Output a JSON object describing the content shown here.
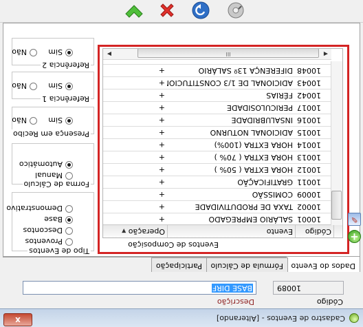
{
  "window": {
    "title": "Cadastro de Eventos - [Alterando]",
    "close_label": "x"
  },
  "fields": {
    "codigo_label": "Código",
    "codigo_value": "10089",
    "descricao_label": "Descrição",
    "descricao_value": "BASE DIRF"
  },
  "tabs": [
    {
      "label": "Dados do Evento",
      "active": true
    },
    {
      "label": "Fórmula de Cálculo",
      "active": false
    },
    {
      "label": "Participação",
      "active": false
    }
  ],
  "groups": {
    "tipo_eventos": {
      "title": "Tipo de Eventos",
      "options": [
        "Proventos",
        "Descontos",
        "Base",
        "Demonstrativo"
      ],
      "selected": "Base"
    },
    "forma_calculo": {
      "title": "Forma de Cálculo",
      "options": [
        "Manual",
        "Automático"
      ],
      "selected": "Automático"
    },
    "presenca_recibo": {
      "title": "Presença em Recibo",
      "options": [
        "Sim",
        "Não"
      ],
      "selected": "Sim"
    },
    "referencia_1": {
      "title": "Referência 1",
      "options": [
        "Sim",
        "Não"
      ],
      "selected": "Sim"
    },
    "referencia_2": {
      "title": "Referência 2",
      "options": [
        "Sim",
        "Não"
      ],
      "selected": "Sim"
    }
  },
  "composicao": {
    "title": "Eventos de Composição",
    "columns": [
      "Código",
      "Evento",
      "Operação"
    ],
    "rows": [
      {
        "code": "10001",
        "event": "SALÁRIO EMPREGADO",
        "op": "+",
        "current": true
      },
      {
        "code": "10002",
        "event": "TAXA DE PRODUTIVIDADE",
        "op": "+",
        "current": false
      },
      {
        "code": "10009",
        "event": "COMISSÃO",
        "op": "+",
        "current": false
      },
      {
        "code": "10011",
        "event": "GRATIFICAÇÃO",
        "op": "+",
        "current": false
      },
      {
        "code": "10012",
        "event": "HORA EXTRA ( 50% )",
        "op": "+",
        "current": false
      },
      {
        "code": "10013",
        "event": "HORA EXTRA ( 70% )",
        "op": "+",
        "current": false
      },
      {
        "code": "10014",
        "event": "HORA EXTRA (100%)",
        "op": "+",
        "current": false
      },
      {
        "code": "10015",
        "event": "ADICIONAL NOTURNO",
        "op": "+",
        "current": false
      },
      {
        "code": "10016",
        "event": "INSALUBRIDADE",
        "op": "+",
        "current": false
      },
      {
        "code": "10017",
        "event": "PERICULOSIDADE",
        "op": "+",
        "current": false
      },
      {
        "code": "10042",
        "event": "FÉRIAS",
        "op": "+",
        "current": false
      },
      {
        "code": "10043",
        "event": "ADICIONAL DE 1/3 CONSTITUCIONAL",
        "op": "+",
        "current": false
      },
      {
        "code": "10048",
        "event": "DIFERENÇA 13º SALÁRIO",
        "op": "+",
        "current": false
      }
    ],
    "scrollbar_thumb_label": "III"
  },
  "toolbar": [
    "up-arrow-icon",
    "cancel-icon",
    "refresh-icon",
    "settings-disc-icon"
  ]
}
